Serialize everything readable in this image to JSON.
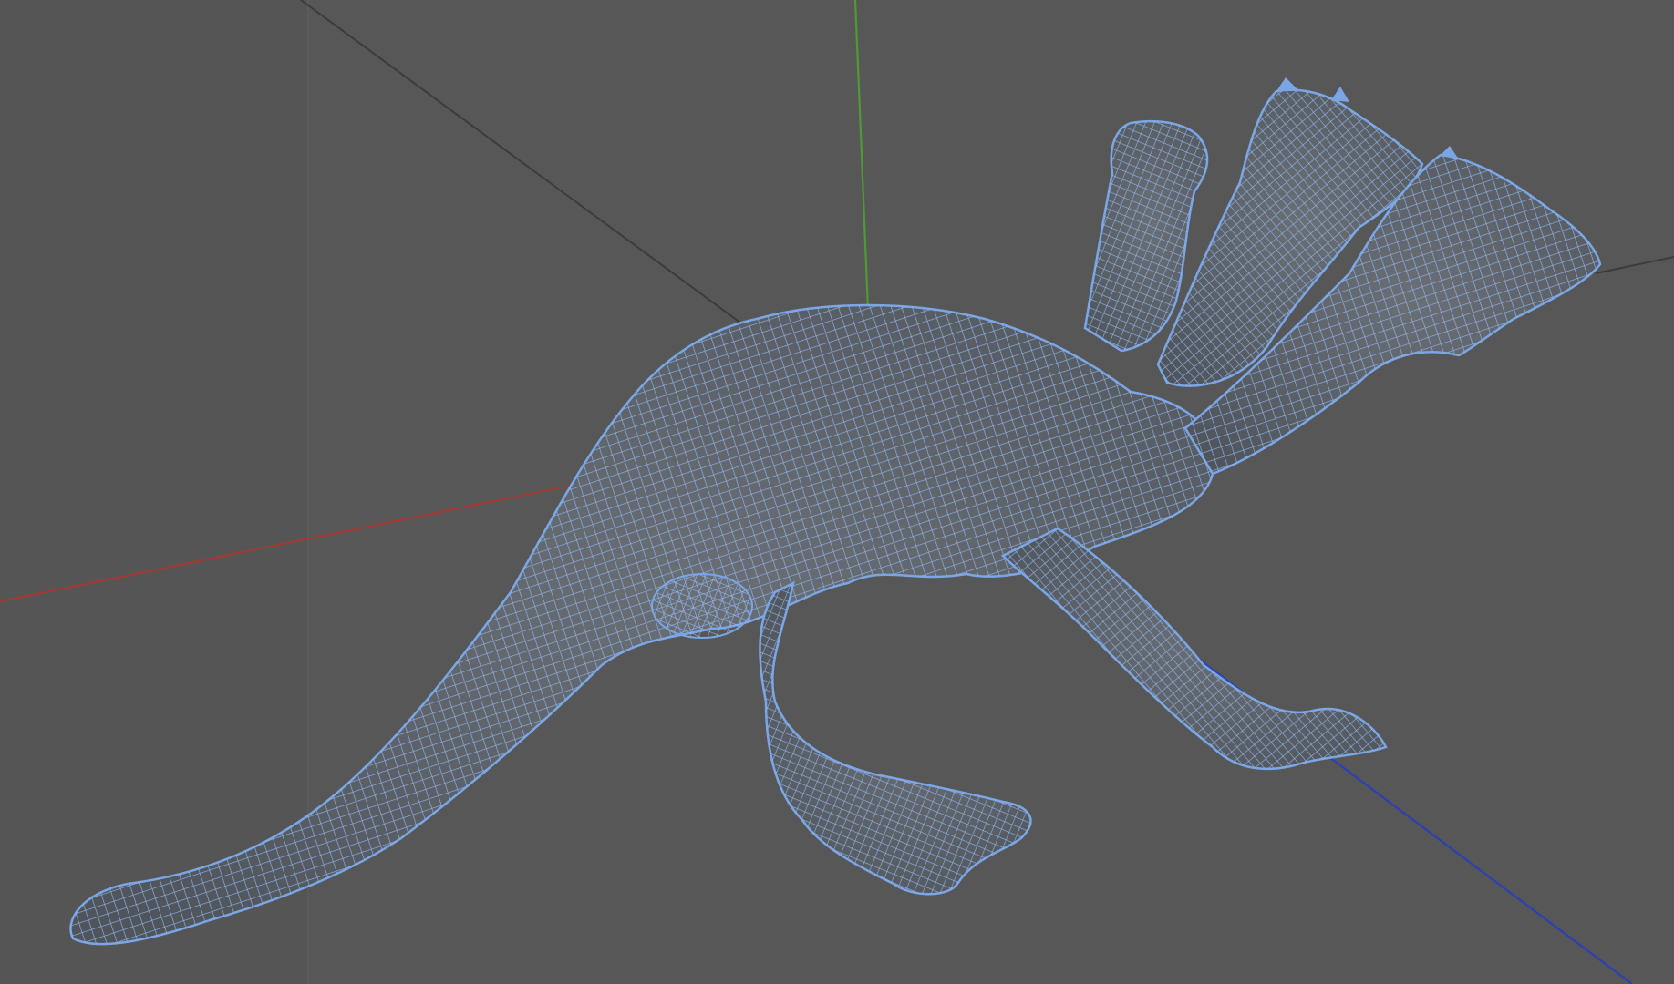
{
  "viewport": {
    "view_mode": "perspective",
    "display_mode": "wireframe",
    "background_color": "#575757",
    "grid_color": "#454545",
    "mesh_wire_color": "#7aa6e6",
    "mesh_fill_color": "#5c6268",
    "axes": {
      "x_color": "#a03a33",
      "y_color": "#4d9a34",
      "z_color": "#2b3fb8"
    },
    "object": {
      "description_icon": "three-headed-dragon-mesh"
    }
  }
}
